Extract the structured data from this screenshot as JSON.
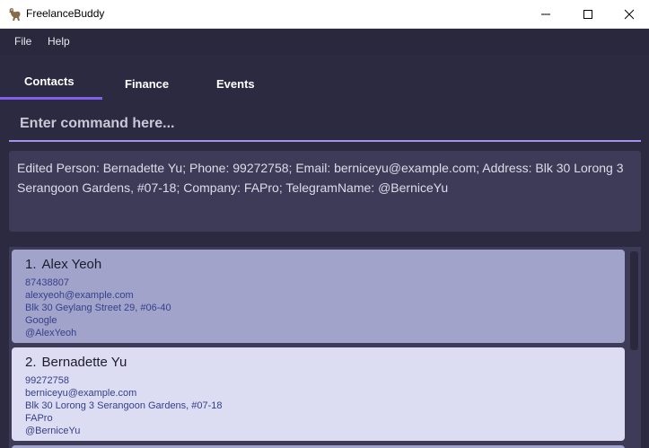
{
  "window": {
    "title": "FreelanceBuddy"
  },
  "menu": {
    "items": [
      "File",
      "Help"
    ]
  },
  "tabs": [
    {
      "label": "Contacts",
      "active": true
    },
    {
      "label": "Finance",
      "active": false
    },
    {
      "label": "Events",
      "active": false
    }
  ],
  "command": {
    "placeholder": "Enter command here..."
  },
  "result": {
    "text": "Edited Person: Bernadette Yu; Phone: 99272758; Email: berniceyu@example.com; Address: Blk 30 Lorong 3 Serangoon Gardens, #07-18; Company: FAPro; TelegramName: @BerniceYu"
  },
  "persons": [
    {
      "index": "1.",
      "name": "Alex Yeoh",
      "phone": "87438807",
      "email": "alexyeoh@example.com",
      "address": "Blk 30 Geylang Street 29, #06-40",
      "company": "Google",
      "telegram": "@AlexYeoh"
    },
    {
      "index": "2.",
      "name": "Bernadette Yu",
      "phone": "99272758",
      "email": "berniceyu@example.com",
      "address": "Blk 30 Lorong 3 Serangoon Gardens, #07-18",
      "company": "FAPro",
      "telegram": "@BerniceYu"
    }
  ],
  "colors": {
    "accent": "#8060e8",
    "background": "#2c2a40",
    "card_selected": "#a1a3cb",
    "card_default": "#dcdcf3"
  }
}
